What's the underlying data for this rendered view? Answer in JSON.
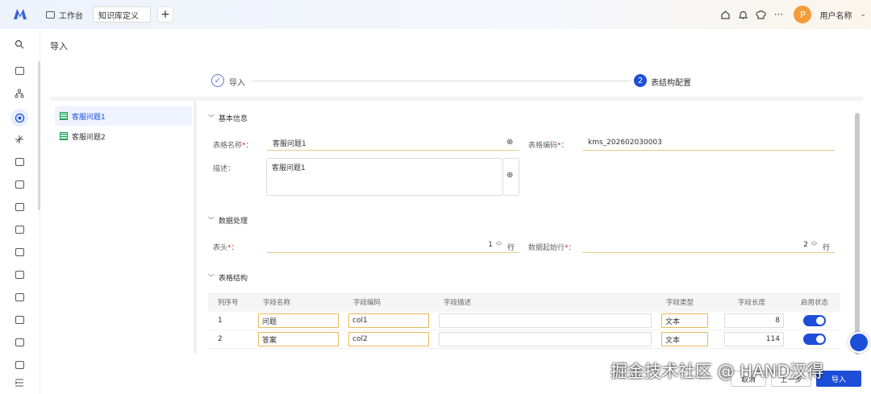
{
  "topbar": {
    "workbench_label": "工作台",
    "active_tab_label": "知识库定义",
    "add_tab": "+",
    "user_initial": "P",
    "user_name": "用户名称"
  },
  "page": {
    "title": "导入"
  },
  "steps": [
    {
      "label": "导入",
      "status": "done"
    },
    {
      "number": "2",
      "label": "表结构配置",
      "status": "current"
    }
  ],
  "sheets": [
    {
      "label": "客服问题1",
      "active": true
    },
    {
      "label": "客服问题2",
      "active": false
    }
  ],
  "sections": {
    "basic": "基本信息",
    "data_processing": "数据处理",
    "table_structure": "表格结构"
  },
  "basic": {
    "table_name_label": "表格名称",
    "table_name_value": "客服问题1",
    "table_code_label": "表格编码",
    "table_code_value": "kms_202602030003",
    "desc_label": "描述",
    "desc_value": "客服问题1"
  },
  "processing": {
    "header_label": "表头",
    "header_value": "1",
    "header_unit": "行",
    "start_row_label": "数据起始行",
    "start_row_value": "2",
    "start_row_unit": "行"
  },
  "table": {
    "columns": [
      "列序号",
      "字段名称",
      "字段编码",
      "字段描述",
      "字段类型",
      "字段长度",
      "启用状态"
    ],
    "rows": [
      {
        "index": "1",
        "name": "问题",
        "code": "col1",
        "desc": "",
        "type": "文本",
        "length": "8",
        "enabled": true
      },
      {
        "index": "2",
        "name": "答案",
        "code": "col2",
        "desc": "",
        "type": "文本",
        "length": "114",
        "enabled": true
      }
    ]
  },
  "footer": {
    "cancel_label": "取消",
    "prev_label": "上一步",
    "import_label": "导入"
  },
  "watermark": "掘金技术社区 @ HAND汉得",
  "colors": {
    "primary": "#1d4ed8",
    "required": "#e0301e",
    "field_underline": "#e6c98a",
    "avatar": "#f39c3b"
  }
}
